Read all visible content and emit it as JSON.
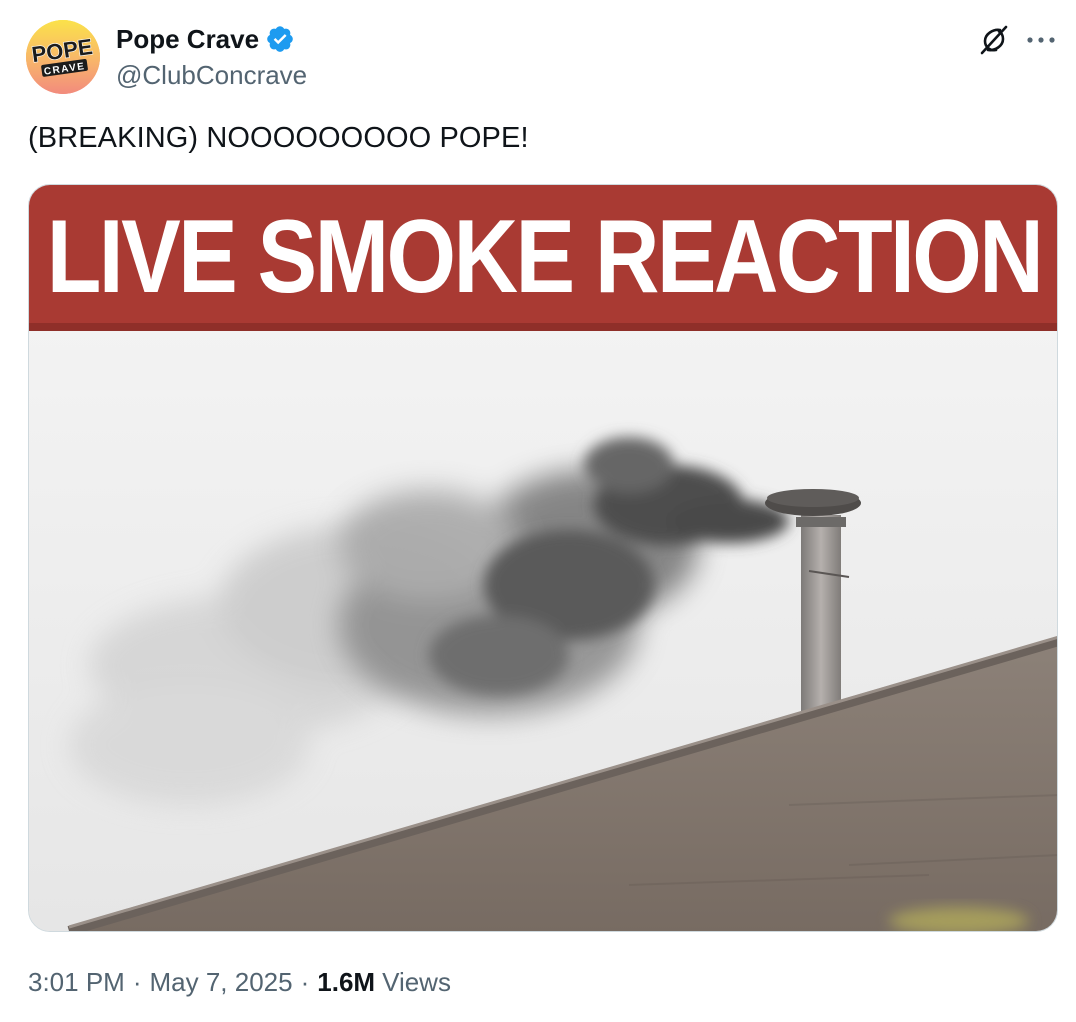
{
  "author": {
    "display_name": "Pope Crave",
    "handle": "@ClubConcrave",
    "verified": true,
    "verified_color": "#1d9bf0",
    "avatar_text_top": "POPE",
    "avatar_text_bottom": "CRAVE"
  },
  "header_actions": {
    "grok_icon": "grok-icon",
    "more_icon": "more-icon"
  },
  "tweet": {
    "text": "(BREAKING) NOOOOOOOOO POPE!"
  },
  "media": {
    "banner_text": "LIVE SMOKE REACTION",
    "banner_color": "#a93a33",
    "depicts": [
      "sky",
      "black-smoke",
      "chimney",
      "roof"
    ]
  },
  "meta": {
    "time": "3:01 PM",
    "separator": "·",
    "date": "May 7, 2025",
    "views_count": "1.6M",
    "views_label": "Views"
  }
}
